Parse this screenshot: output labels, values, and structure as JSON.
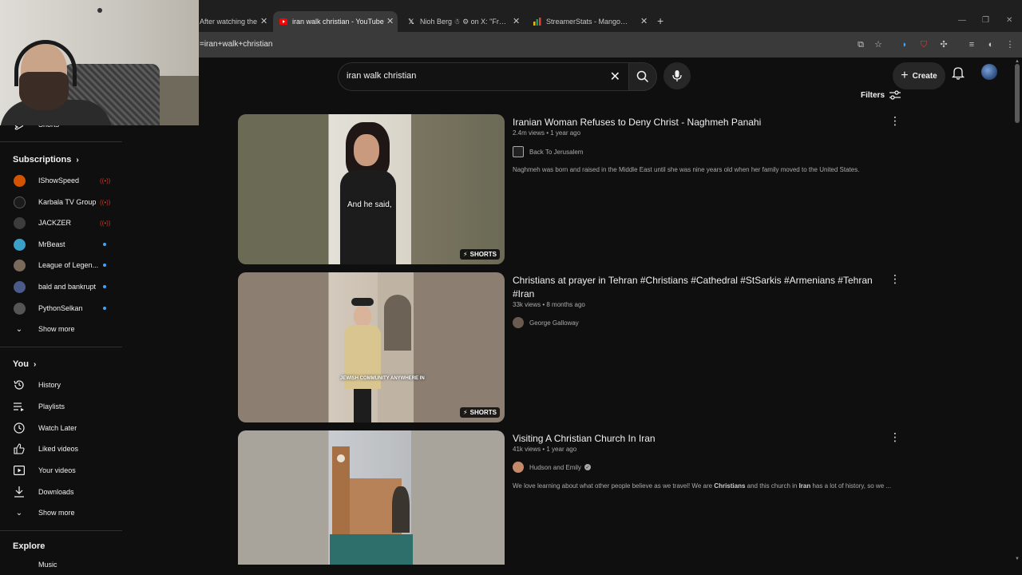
{
  "browser": {
    "tabs": [
      {
        "label": "After watching the",
        "active": false
      },
      {
        "label": "iran walk christian - YouTube",
        "active": true
      },
      {
        "label": "Nioh Berg ☃ ⚙ on X: \"From iran",
        "active": false
      },
      {
        "label": "StreamerStats - MangoCurry's",
        "active": false
      }
    ],
    "url": "=iran+walk+christian"
  },
  "header": {
    "search_query": "iran walk christian",
    "create_label": "Create",
    "filters_label": "Filters"
  },
  "sidebar": {
    "shorts_label": "Shorts",
    "subscriptions_heading": "Subscriptions",
    "subscriptions": [
      {
        "name": "IShowSpeed",
        "status": "live",
        "color": "#d35400"
      },
      {
        "name": "Karbala TV Group",
        "status": "live",
        "color": "#1b1b1b"
      },
      {
        "name": "JACKZER",
        "status": "live",
        "color": "#3c3c3c"
      },
      {
        "name": "MrBeast",
        "status": "new",
        "color": "#3aa0c8"
      },
      {
        "name": "League of Legen...",
        "status": "new",
        "color": "#7a6a5a"
      },
      {
        "name": "bald and bankrupt",
        "status": "new",
        "color": "#4a5a8a"
      },
      {
        "name": "PythonSelkan",
        "status": "new",
        "color": "#555555"
      }
    ],
    "show_more_1": "Show more",
    "you_heading": "You",
    "you_items": [
      {
        "label": "History",
        "icon": "history-icon"
      },
      {
        "label": "Playlists",
        "icon": "playlists-icon"
      },
      {
        "label": "Watch Later",
        "icon": "watch-later-icon"
      },
      {
        "label": "Liked videos",
        "icon": "like-icon"
      },
      {
        "label": "Your videos",
        "icon": "your-videos-icon"
      },
      {
        "label": "Downloads",
        "icon": "download-icon"
      }
    ],
    "show_more_2": "Show more",
    "explore_heading": "Explore",
    "music_label": "Music"
  },
  "results": [
    {
      "title": "Iranian Woman Refuses to Deny Christ - Naghmeh Panahi",
      "meta": "2.4m views • 1 year ago",
      "channel": "Back To Jerusalem",
      "description": "Naghmeh was born and raised in the Middle East until she was nine years old when her family moved to the United States.",
      "badge": "SHORTS",
      "caption": "And he said,"
    },
    {
      "title": "Christians at prayer in Tehran #Christians #Cathedral #StSarkis #Armenians #Tehran #Iran",
      "meta": "33k views • 8 months ago",
      "channel": "George Galloway",
      "badge": "SHORTS",
      "caption": "JEWISH COMMUNITY ANYWHERE IN"
    },
    {
      "title": "Visiting A Christian Church In Iran",
      "meta": "41k views • 1 year ago",
      "channel": "Hudson and Emily",
      "desc_parts": [
        "We love learning about what other people believe as we travel! We are ",
        "Christians",
        " and this church in ",
        "Iran",
        " has a lot of history, so we ..."
      ]
    }
  ]
}
